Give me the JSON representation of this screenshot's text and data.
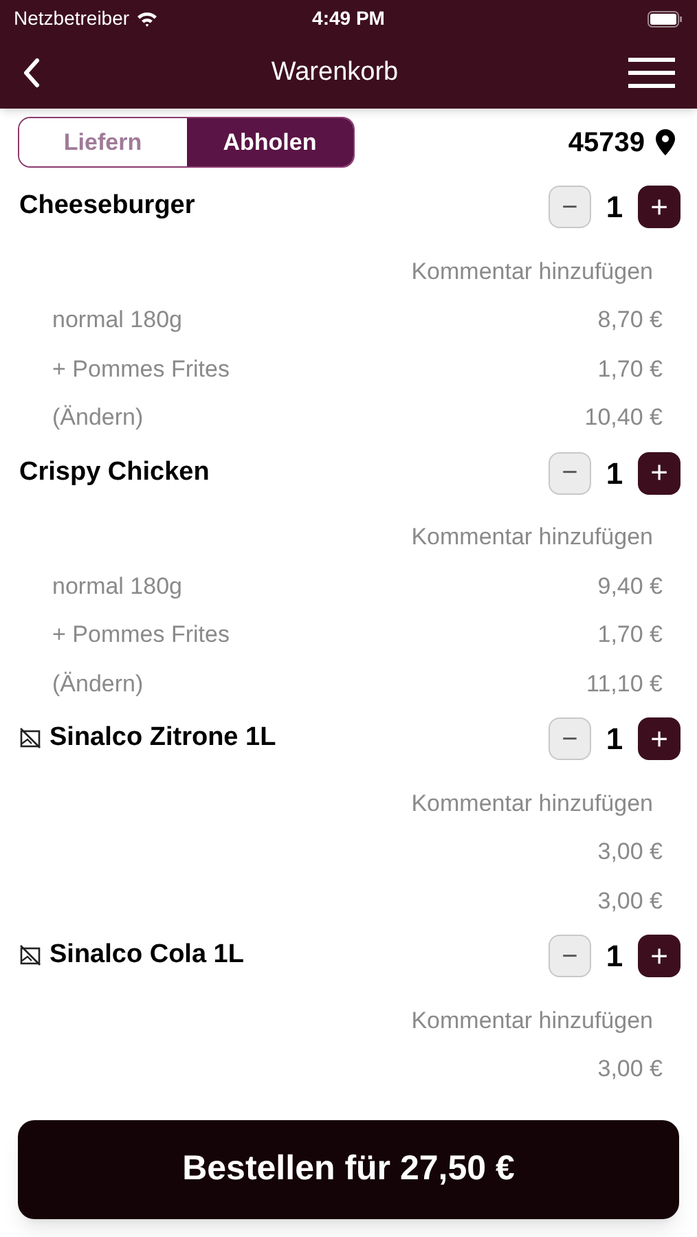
{
  "status_bar": {
    "carrier": "Netzbetreiber",
    "time": "4:49 PM"
  },
  "nav": {
    "title": "Warenkorb"
  },
  "mode_tabs": [
    {
      "label": "Liefern",
      "selected": false
    },
    {
      "label": "Abholen",
      "selected": true
    }
  ],
  "postcode": "45739",
  "items": [
    {
      "kind": "plain",
      "name": "Cheeseburger",
      "minus": "−",
      "quantity": "1",
      "plus": "+",
      "comment": "Kommentar hinzufügen",
      "lines": [
        {
          "label": "normal 180g",
          "price": "8,70 €"
        },
        {
          "label": "+ Pommes Frites",
          "price": "1,70 €"
        },
        {
          "label": "(Ändern)",
          "price": "10,40 €"
        }
      ]
    },
    {
      "kind": "plain",
      "name": "Crispy Chicken",
      "minus": "−",
      "quantity": "1",
      "plus": "+",
      "comment": "Kommentar hinzufügen",
      "lines": [
        {
          "label": "normal 180g",
          "price": "9,40 €"
        },
        {
          "label": "+ Pommes Frites",
          "price": "1,70 €"
        },
        {
          "label": "(Ändern)",
          "price": "11,10 €"
        }
      ]
    },
    {
      "kind": "no-image",
      "name": "Sinalco Zitrone 1L",
      "minus": "−",
      "quantity": "1",
      "plus": "+",
      "comment": "Kommentar hinzufügen",
      "lines": [
        {
          "price": "3,00 €"
        },
        {
          "price": "3,00 €"
        }
      ]
    },
    {
      "kind": "no-image",
      "name": "Sinalco Cola 1L",
      "minus": "−",
      "quantity": "1",
      "plus": "+",
      "comment": "Kommentar hinzufügen",
      "lines": [
        {
          "price": "3,00 €"
        }
      ]
    }
  ],
  "order_button": "Bestellen für 27,50 €"
}
